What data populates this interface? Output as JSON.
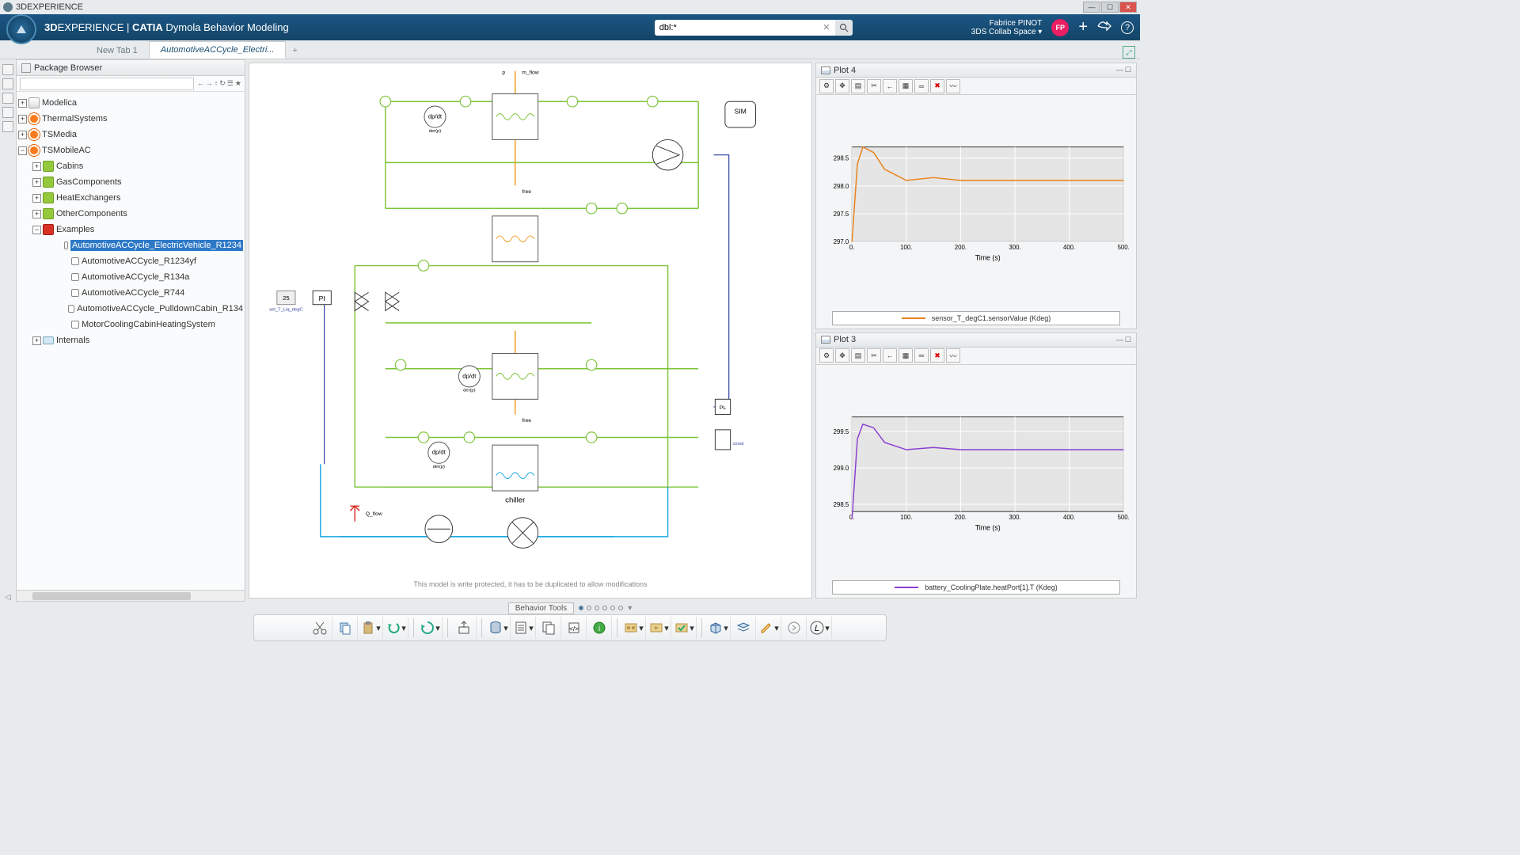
{
  "titlebar": {
    "app": "3DEXPERIENCE"
  },
  "compass": {
    "brand_bold": "3D",
    "brand_rest": "EXPERIENCE | ",
    "suite": "CATIA",
    "product": " Dymola Behavior Modeling"
  },
  "search": {
    "value": "dbl:*",
    "clear": "✕"
  },
  "user": {
    "name": "Fabrice PINOT",
    "space": "3DS Collab Space ▾",
    "initials": "FP"
  },
  "tabs": {
    "t1": "New Tab 1",
    "t2": "AutomotiveACCycle_Electri..."
  },
  "pkg": {
    "title": "Package Browser"
  },
  "tree": {
    "modelica": "Modelica",
    "thermal": "ThermalSystems",
    "tsmedia": "TSMedia",
    "tsmobile": "TSMobileAC",
    "cabins": "Cabins",
    "gascomp": "GasComponents",
    "heatex": "HeatExchangers",
    "othercomp": "OtherComponents",
    "examples": "Examples",
    "ex1": "AutomotiveACCycle_ElectricVehicle_R1234",
    "ex2": "AutomotiveACCycle_R1234yf",
    "ex3": "AutomotiveACCycle_R134a",
    "ex4": "AutomotiveACCycle_R744",
    "ex5": "AutomotiveACCycle_PulldownCabin_R134",
    "ex6": "MotorCoolingCabinHeatingSystem",
    "internals": "Internals"
  },
  "diagram": {
    "sim": "SIM",
    "pi": "PI",
    "dpdt": "dp/dt",
    "der": "der(p)",
    "PL": "PL",
    "val25": "25",
    "set": "set_T_Liq_degC",
    "chiller": "chiller",
    "const": "const",
    "m_flow": "m_flow",
    "p": "p",
    "free": "free",
    "q_flow": "Q_flow",
    "writeprotect": "This model is write protected, it has to be duplicated to allow modifications"
  },
  "plots": {
    "p4": {
      "title": "Plot 4",
      "xlabel": "Time (s)",
      "legend": "sensor_T_degC1.sensorValue (Kdeg)"
    },
    "p3": {
      "title": "Plot 3",
      "xlabel": "Time (s)",
      "legend": "battery_CoolingPlate.heatPort[1].T (Kdeg)"
    }
  },
  "behavior": {
    "label": "Behavior Tools"
  },
  "chart_data": [
    {
      "type": "line",
      "title": "Plot 4",
      "xlabel": "Time (s)",
      "x": [
        0,
        10,
        20,
        40,
        60,
        100,
        150,
        200,
        300,
        400,
        500
      ],
      "series": [
        {
          "name": "sensor_T_degC1.sensorValue (Kdeg)",
          "color": "#e8821a",
          "values": [
            297.0,
            298.4,
            298.7,
            298.6,
            298.3,
            298.1,
            298.15,
            298.1,
            298.1,
            298.1,
            298.1
          ]
        }
      ],
      "ylim": [
        297.0,
        298.7
      ],
      "xlim": [
        0,
        500
      ],
      "yticks": [
        297.0,
        297.5,
        298.0,
        298.5
      ]
    },
    {
      "type": "line",
      "title": "Plot 3",
      "xlabel": "Time (s)",
      "x": [
        0,
        10,
        20,
        40,
        60,
        100,
        150,
        200,
        300,
        400,
        500
      ],
      "series": [
        {
          "name": "battery_CoolingPlate.heatPort[1].T (Kdeg)",
          "color": "#8a3fd1",
          "values": [
            298.3,
            299.4,
            299.6,
            299.55,
            299.35,
            299.25,
            299.28,
            299.25,
            299.25,
            299.25,
            299.25
          ]
        }
      ],
      "ylim": [
        298.4,
        299.7
      ],
      "xlim": [
        0,
        500
      ],
      "yticks": [
        298.5,
        299.0,
        299.5
      ]
    }
  ]
}
